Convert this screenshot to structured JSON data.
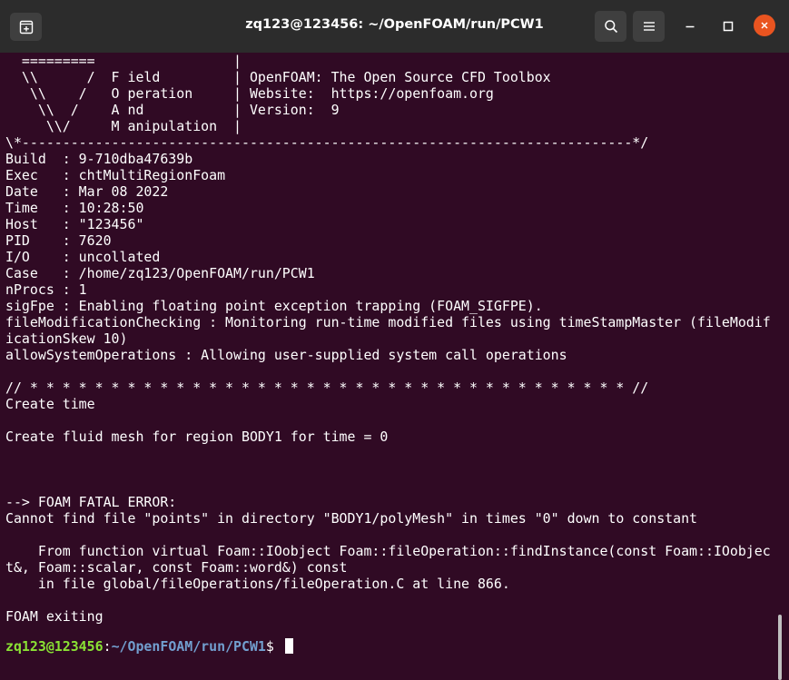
{
  "window": {
    "title": "zq123@123456: ~/OpenFOAM/run/PCW1"
  },
  "icons": {
    "new_tab": "new-tab-icon",
    "search": "search-icon",
    "menu": "hamburger-menu-icon",
    "minimize": "minimize-icon",
    "maximize": "maximize-icon",
    "close": "close-icon"
  },
  "colors": {
    "background": "#300a24",
    "titlebar": "#2c2c2c",
    "close_button": "#e95420",
    "prompt_user": "#8ae234",
    "prompt_path": "#729fcf",
    "text": "#ffffff"
  },
  "terminal": {
    "lines": [
      "  =========                 |",
      "  \\\\      /  F ield         | OpenFOAM: The Open Source CFD Toolbox",
      "   \\\\    /   O peration     | Website:  https://openfoam.org",
      "    \\\\  /    A nd           | Version:  9",
      "     \\\\/     M anipulation  |",
      "\\*---------------------------------------------------------------------------*/",
      "Build  : 9-710dba47639b",
      "Exec   : chtMultiRegionFoam",
      "Date   : Mar 08 2022",
      "Time   : 10:28:50",
      "Host   : \"123456\"",
      "PID    : 7620",
      "I/O    : uncollated",
      "Case   : /home/zq123/OpenFOAM/run/PCW1",
      "nProcs : 1",
      "sigFpe : Enabling floating point exception trapping (FOAM_SIGFPE).",
      "fileModificationChecking : Monitoring run-time modified files using timeStampMaster (fileModif",
      "icationSkew 10)",
      "allowSystemOperations : Allowing user-supplied system call operations",
      "",
      "// * * * * * * * * * * * * * * * * * * * * * * * * * * * * * * * * * * * * * //",
      "Create time",
      "",
      "Create fluid mesh for region BODY1 for time = 0",
      "",
      "",
      "",
      "--> FOAM FATAL ERROR:",
      "Cannot find file \"points\" in directory \"BODY1/polyMesh\" in times \"0\" down to constant",
      "",
      "    From function virtual Foam::IOobject Foam::fileOperation::findInstance(const Foam::IOobjec",
      "t&, Foam::scalar, const Foam::word&) const",
      "    in file global/fileOperations/fileOperation.C at line 866.",
      "",
      "FOAM exiting",
      ""
    ],
    "prompt": {
      "user_host": "zq123@123456",
      "separator": ":",
      "path": "~/OpenFOAM/run/PCW1",
      "symbol": "$ "
    }
  }
}
